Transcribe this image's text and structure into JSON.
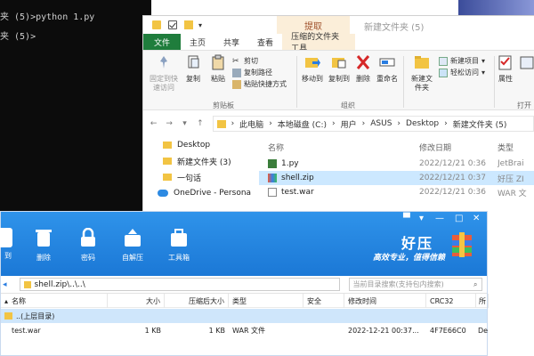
{
  "console": {
    "line1": "夹 (5)>python 1.py",
    "line2": "夹 (5)>"
  },
  "explorer": {
    "context_tab": "提取",
    "window_title": "新建文件夹 (5)",
    "tabs": [
      "文件",
      "主页",
      "共享",
      "查看",
      "压缩的文件夹工具"
    ],
    "ribbon": {
      "pin": "固定到快速访问",
      "copy": "复制",
      "paste": "粘贴",
      "cut": "剪切",
      "copy_path": "复制路径",
      "paste_shortcut": "粘贴快捷方式",
      "clipboard_group": "剪贴板",
      "move_to": "移动到",
      "copy_to": "复制到",
      "delete": "删除",
      "rename": "重命名",
      "organize_group": "组织",
      "new_folder": "新建文件夹",
      "new_item": "新建项目",
      "easy_access": "轻松访问",
      "properties": "属性",
      "open_group": "打开"
    },
    "address": [
      "此电脑",
      "本地磁盘 (C:)",
      "用户",
      "ASUS",
      "Desktop",
      "新建文件夹 (5)"
    ],
    "nav_items": [
      "Desktop",
      "新建文件夹 (3)",
      "一句话",
      "OneDrive - Persona"
    ],
    "list_headers": {
      "name": "名称",
      "date": "修改日期",
      "type": "类型"
    },
    "files": [
      {
        "name": "1.py",
        "date": "2022/12/21 0:36",
        "type": "JetBrai"
      },
      {
        "name": "shell.zip",
        "date": "2022/12/21 0:37",
        "type": "好压 ZI"
      },
      {
        "name": "test.war",
        "date": "2022/12/21 0:36",
        "type": "WAR 文"
      }
    ]
  },
  "haozip": {
    "buttons": [
      "到",
      "删除",
      "密码",
      "自解压",
      "工具箱"
    ],
    "brand": "好压",
    "slogan": "高效专业，值得信赖",
    "path": "shell.zip\\..\\..\\",
    "search_placeholder": "当前目录搜索(支持包内搜索)",
    "headers": [
      "名称",
      "大小",
      "压缩后大小",
      "类型",
      "安全",
      "修改时间",
      "CRC32",
      "所"
    ],
    "parent_row": "..(上层目录)",
    "file_row": {
      "name": "test.war",
      "size": "1 KB",
      "packed": "1 KB",
      "type": "WAR 文件",
      "modified": "2022-12-21 00:37...",
      "crc": "4F7E66C0",
      "owner": "De"
    }
  }
}
